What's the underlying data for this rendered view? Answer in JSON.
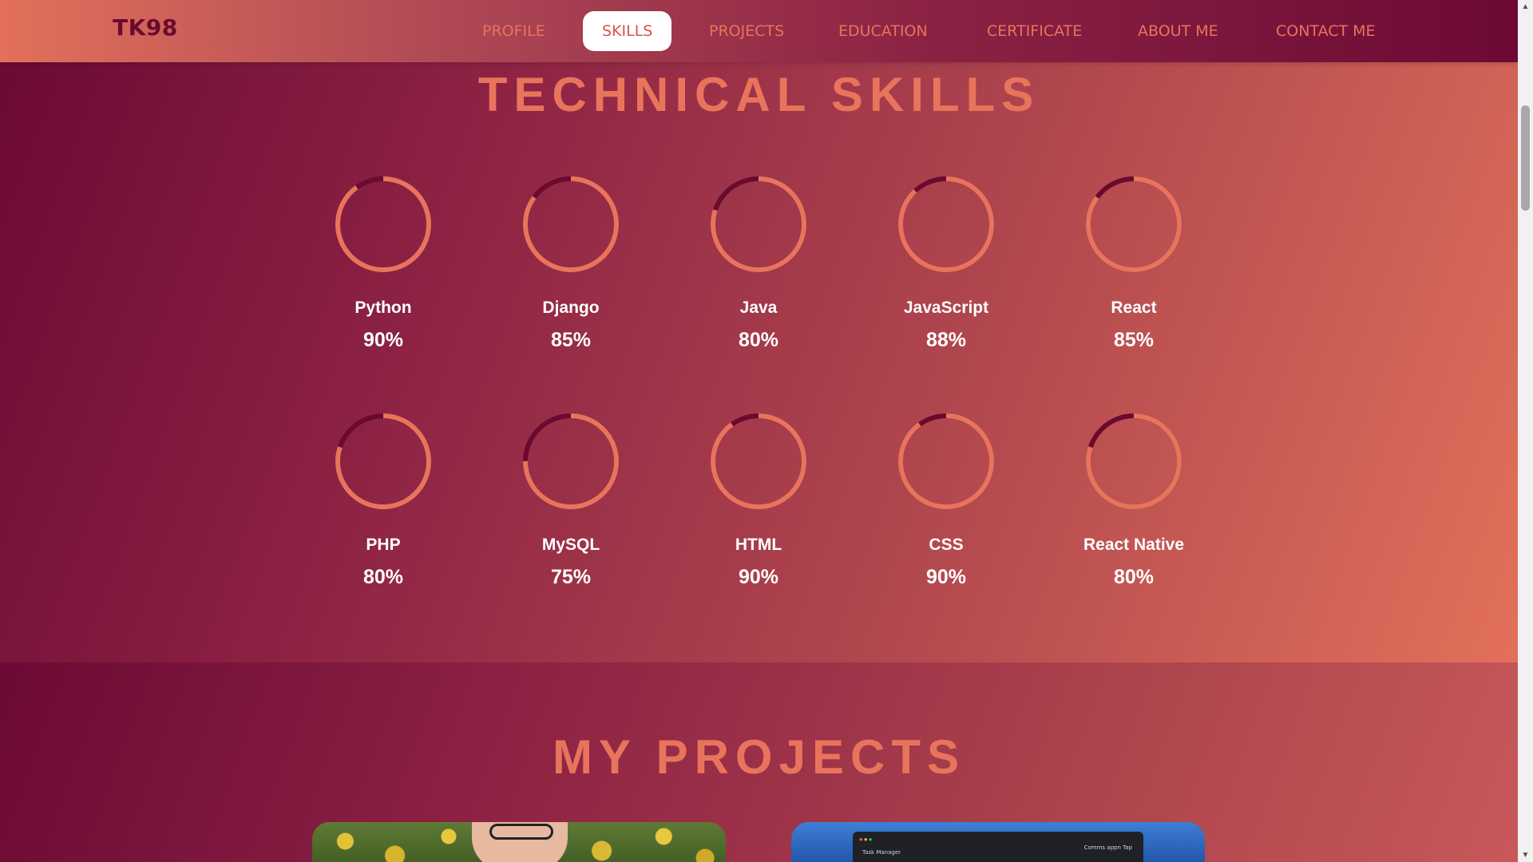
{
  "nav": {
    "brand": "TK98",
    "links": [
      "PROFILE",
      "SKILLS",
      "PROJECTS",
      "EDUCATION",
      "CERTIFICATE",
      "ABOUT ME",
      "CONTACT ME"
    ],
    "active": "SKILLS"
  },
  "skills": {
    "title": "TECHNICAL SKILLS",
    "items": [
      {
        "name": "Python",
        "percent_label": "90%",
        "percent": 90
      },
      {
        "name": "Django",
        "percent_label": "85%",
        "percent": 85
      },
      {
        "name": "Java",
        "percent_label": "80%",
        "percent": 80
      },
      {
        "name": "JavaScript",
        "percent_label": "88%",
        "percent": 88
      },
      {
        "name": "React",
        "percent_label": "85%",
        "percent": 85
      },
      {
        "name": "PHP",
        "percent_label": "80%",
        "percent": 80
      },
      {
        "name": "MySQL",
        "percent_label": "75%",
        "percent": 75
      },
      {
        "name": "HTML",
        "percent_label": "90%",
        "percent": 90
      },
      {
        "name": "CSS",
        "percent_label": "90%",
        "percent": 90
      },
      {
        "name": "React Native",
        "percent_label": "80%",
        "percent": 80
      }
    ]
  },
  "projects": {
    "title": "MY PROJECTS",
    "cards": [
      {
        "image": "portrait-in-flower-field"
      },
      {
        "image": "task-manager-app-screenshot",
        "window_title": "Task Manager",
        "window_search": "Comms appn Tap"
      }
    ]
  },
  "colors": {
    "accent": "#e8745c",
    "ring_track": "#6a0a2e",
    "active_nav_bg": "#ffffff",
    "dark_maroon": "#6b0a35"
  }
}
